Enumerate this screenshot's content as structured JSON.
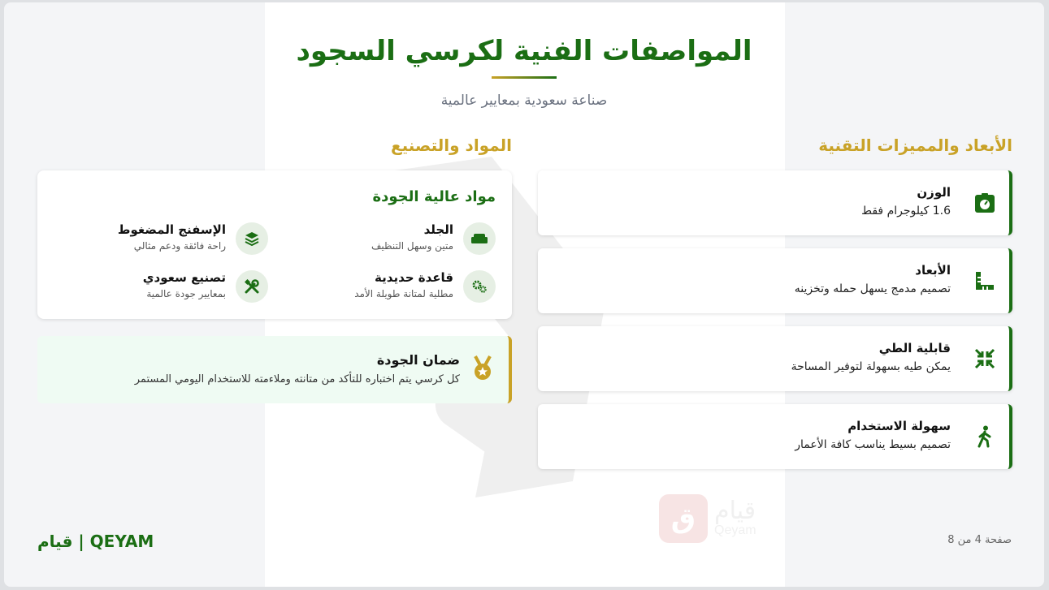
{
  "header": {
    "title": "المواصفات الفنية لكرسي السجود",
    "subtitle": "صناعة سعودية بمعايير عالمية"
  },
  "sections": {
    "specs_heading": "الأبعاد والمميزات التقنية",
    "materials_heading": "المواد والتصنيع"
  },
  "specs": [
    {
      "title": "الوزن",
      "desc": "1.6 كيلوجرام فقط",
      "icon": "scale-icon"
    },
    {
      "title": "الأبعاد",
      "desc": "تصميم مدمج يسهل حمله وتخزينه",
      "icon": "ruler-icon"
    },
    {
      "title": "قابلية الطي",
      "desc": "يمكن طيه بسهولة لتوفير المساحة",
      "icon": "compress-icon"
    },
    {
      "title": "سهولة الاستخدام",
      "desc": "تصميم بسيط يناسب كافة الأعمار",
      "icon": "walking-person-icon"
    }
  ],
  "materials": {
    "title": "مواد عالية الجودة",
    "items": [
      {
        "name": "الجلد",
        "desc": "متين وسهل التنظيف",
        "icon": "couch-icon"
      },
      {
        "name": "الإسفنج المضغوط",
        "desc": "راحة فائقة ودعم مثالي",
        "icon": "layers-icon"
      },
      {
        "name": "قاعدة حديدية",
        "desc": "مطلية لمتانة طويلة الأمد",
        "icon": "gears-icon"
      },
      {
        "name": "تصنيع سعودي",
        "desc": "بمعايير جودة عالمية",
        "icon": "tools-icon"
      }
    ]
  },
  "quality": {
    "title": "ضمان الجودة",
    "desc": "كل كرسي يتم اختباره للتأكد من متانته وملاءمته للاستخدام اليومي المستمر",
    "icon": "medal-icon"
  },
  "footer": {
    "page": "صفحة 4 من 8",
    "brand": "QEYAM | قيام"
  },
  "watermark": {
    "letter": "ق",
    "arabic": "قيام",
    "english": "Qeyam"
  },
  "colors": {
    "primary": "#1b6e14",
    "accent": "#c9a227",
    "quality_bg": "#effbf3"
  }
}
